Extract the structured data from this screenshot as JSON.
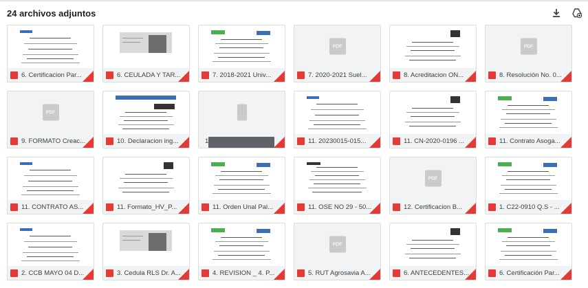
{
  "header": {
    "title": "24 archivos adjuntos",
    "download_icon": "download-icon",
    "drive_icon": "add-to-drive-icon"
  },
  "colors": {
    "pdf_red": "#e53935",
    "footer_bg": "#f1f3f4",
    "doc_gray": "#5f6368"
  },
  "attachments": [
    {
      "name": "6. Certificacion Par...",
      "type": "pdf",
      "thumb": "doc"
    },
    {
      "name": "6. CEULADA Y TAR...",
      "type": "pdf",
      "thumb": "id"
    },
    {
      "name": "7. 2018-2021 Univ...",
      "type": "pdf",
      "thumb": "doc"
    },
    {
      "name": "7. 2020-2021 Suel...",
      "type": "pdf",
      "thumb": "blank"
    },
    {
      "name": "8. Acreditacion ON...",
      "type": "pdf",
      "thumb": "doc"
    },
    {
      "name": "8. Resolución No. 0...",
      "type": "pdf",
      "thumb": "blank"
    },
    {
      "name": "9. FORMATO Creac...",
      "type": "pdf",
      "thumb": "blank"
    },
    {
      "name": "10. Declaracion ing...",
      "type": "pdf",
      "thumb": "form"
    },
    {
      "name": "10. Reporte Ley 20...",
      "type": "doc",
      "thumb": "blankdoc"
    },
    {
      "name": "11. 20230015-015...",
      "type": "pdf",
      "thumb": "doc"
    },
    {
      "name": "11. CN-2020-0196 ...",
      "type": "pdf",
      "thumb": "doc"
    },
    {
      "name": "11. Contrato Asoga...",
      "type": "pdf",
      "thumb": "doc"
    },
    {
      "name": "11. CONTRATO AS...",
      "type": "pdf",
      "thumb": "doc"
    },
    {
      "name": "11. Formato_HV_P...",
      "type": "pdf",
      "thumb": "doc"
    },
    {
      "name": "11. Orden Unal Pal...",
      "type": "pdf",
      "thumb": "doc"
    },
    {
      "name": "11. OSE NO 29 - 50...",
      "type": "pdf",
      "thumb": "table"
    },
    {
      "name": "12. Certificacion B...",
      "type": "pdf",
      "thumb": "blank"
    },
    {
      "name": "1. C22-0910 Q.S - ...",
      "type": "pdf",
      "thumb": "doc"
    },
    {
      "name": "2. CCB MAYO 04 D...",
      "type": "pdf",
      "thumb": "doc"
    },
    {
      "name": "3. Cedula RLS Dr. A...",
      "type": "pdf",
      "thumb": "id"
    },
    {
      "name": "4. REVISION _ 4. P...",
      "type": "pdf",
      "thumb": "doc"
    },
    {
      "name": "5. RUT Agrosavia A...",
      "type": "pdf",
      "thumb": "blank"
    },
    {
      "name": "6. ANTECEDENTES...",
      "type": "pdf",
      "thumb": "doc"
    },
    {
      "name": "6. Certificación Par...",
      "type": "pdf",
      "thumb": "doc"
    }
  ],
  "pdf_placeholder": "PDF"
}
